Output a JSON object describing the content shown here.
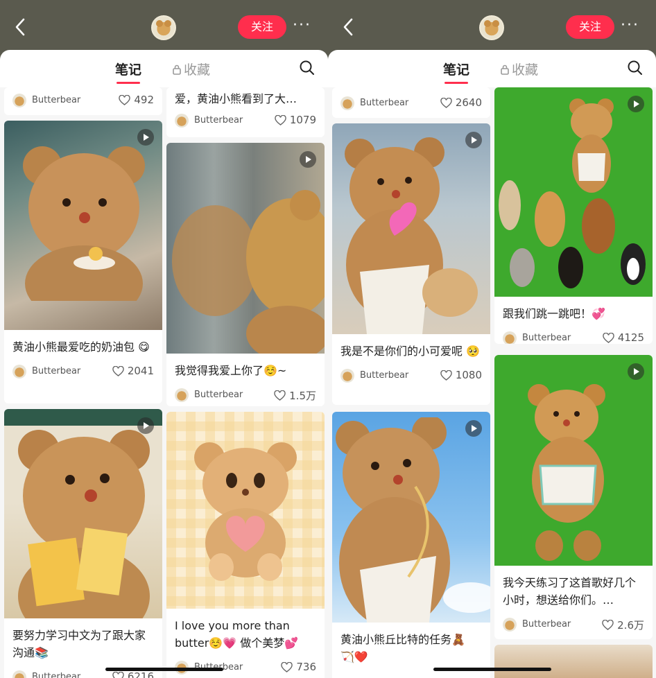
{
  "colors": {
    "accent": "#ff2e4d",
    "topbar": "#5a5a4e"
  },
  "screens": [
    {
      "nav": {
        "follow": "关注",
        "more": "···"
      },
      "tabs": {
        "notes": "笔记",
        "collect": "收藏"
      },
      "cols": [
        [
          {
            "title": "",
            "author": "Butterbear",
            "likes": "492",
            "video": false
          },
          {
            "title": "黄油小熊最爱吃的奶油包 😋",
            "author": "Butterbear",
            "likes": "2041",
            "video": true
          },
          {
            "title": "要努力学习中文为了跟大家沟通📚",
            "author": "Butterbear",
            "likes": "6216",
            "video": true
          }
        ],
        [
          {
            "title": "爱，黄油小熊看到了大…",
            "author": "Butterbear",
            "likes": "1079",
            "video": false
          },
          {
            "title": "我觉得我爱上你了☺️~",
            "author": "Butterbear",
            "likes": "1.5万",
            "video": true
          },
          {
            "title": "I love you more than butter☺️💗 做个美梦💕",
            "author": "Butterbear",
            "likes": "736",
            "video": false
          }
        ]
      ]
    },
    {
      "nav": {
        "follow": "关注",
        "more": "···"
      },
      "tabs": {
        "notes": "笔记",
        "collect": "收藏"
      },
      "cols": [
        [
          {
            "title": "",
            "author": "Butterbear",
            "likes": "2640",
            "video": false
          },
          {
            "title": "我是不是你们的小可爱呢 🥺",
            "author": "Butterbear",
            "likes": "1080",
            "video": true
          },
          {
            "title": "黄油小熊丘比特的任务🧸 🏹❤️",
            "author": "Butterbear",
            "likes": "",
            "video": true
          }
        ],
        [
          {
            "title": "跟我们跳一跳吧！💞",
            "author": "Butterbear",
            "likes": "4125",
            "video": true
          },
          {
            "title": "我今天练习了这首歌好几个小时，想送给你们。…",
            "author": "Butterbear",
            "likes": "2.6万",
            "video": true
          },
          {
            "title": "",
            "author": "",
            "likes": "",
            "video": false
          }
        ]
      ]
    }
  ]
}
